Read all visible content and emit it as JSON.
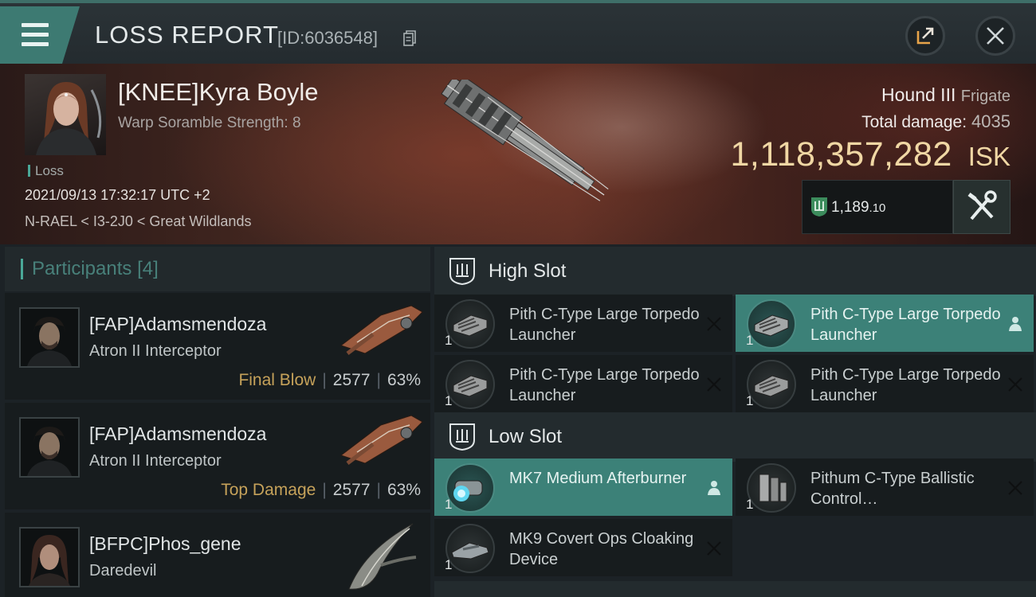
{
  "header": {
    "title": "LOSS REPORT",
    "report_id": "[ID:6036548]"
  },
  "victim": {
    "name": "[KNEE]Kyra Boyle",
    "scramble": "Warp Soramble Strength: 8",
    "status": "Loss",
    "datetime": "2021/09/13 17:32:17 UTC +2",
    "location": "N-RAEL < I3-2J0 < Great Wildlands",
    "ship": "Hound III",
    "ship_class": "Frigate",
    "damage_label": "Total damage:",
    "damage_value": "4035",
    "isk_value": "1,118,357,282",
    "isk_unit": "ISK",
    "lp_value": "1,189",
    "lp_decimal": ".10"
  },
  "participants": {
    "title": "Participants",
    "count": "[4]",
    "items": [
      {
        "name": "[FAP]Adamsmendoza",
        "ship": "Atron II Interceptor",
        "role": "Final Blow",
        "damage": "2577",
        "percent": "63%"
      },
      {
        "name": "[FAP]Adamsmendoza",
        "ship": "Atron II Interceptor",
        "role": "Top Damage",
        "damage": "2577",
        "percent": "63%"
      },
      {
        "name": "[BFPC]Phos_gene",
        "ship": "Daredevil",
        "role": "",
        "damage": "",
        "percent": ""
      }
    ]
  },
  "slots": {
    "high": {
      "title": "High Slot",
      "modules": [
        {
          "qty": "1",
          "name": "Pith C-Type Large Torpedo Launcher",
          "state": "destroyed",
          "icon": "close-icon"
        },
        {
          "qty": "1",
          "name": "Pith C-Type Large Torpedo Launcher",
          "state": "dropped",
          "icon": "person-icon"
        },
        {
          "qty": "1",
          "name": "Pith C-Type Large Torpedo Launcher",
          "state": "destroyed",
          "icon": "close-icon"
        },
        {
          "qty": "1",
          "name": "Pith C-Type Large Torpedo Launcher",
          "state": "destroyed",
          "icon": "close-icon"
        }
      ]
    },
    "low": {
      "title": "Low Slot",
      "modules": [
        {
          "qty": "1",
          "name": "MK7 Medium Afterburner",
          "state": "dropped",
          "icon": "person-icon"
        },
        {
          "qty": "1",
          "name": "Pithum C-Type Ballistic Control…",
          "state": "destroyed",
          "icon": "close-icon"
        },
        {
          "qty": "1",
          "name": "MK9 Covert Ops Cloaking Device",
          "state": "destroyed",
          "icon": "close-icon"
        }
      ]
    }
  },
  "colors": {
    "accent": "#3c8178",
    "isk": "#f0d7a4",
    "final_blow": "#c6a25a"
  }
}
